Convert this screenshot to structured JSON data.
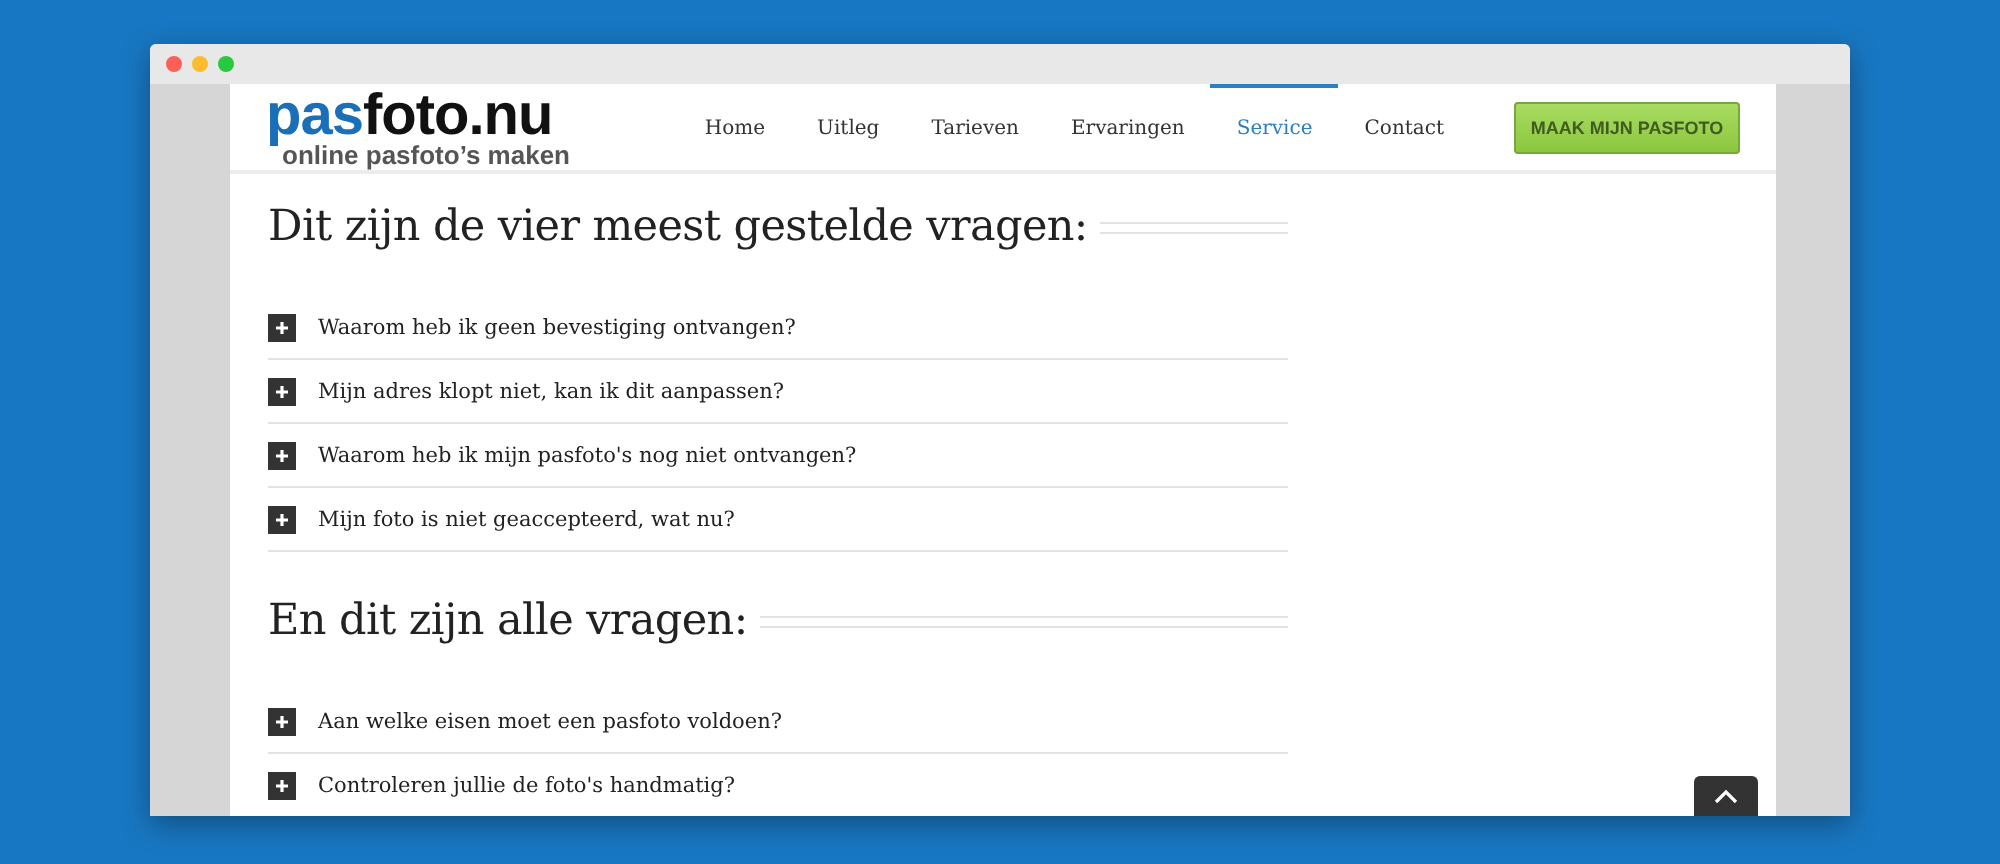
{
  "header": {
    "logo": {
      "wordmark": [
        {
          "text": "pas",
          "color": "#1a6fb8"
        },
        {
          "text": "foto.nu",
          "color": "#111111"
        }
      ],
      "tagline": "online pasfoto’s maken"
    },
    "nav": [
      {
        "label": "Home",
        "selected": false
      },
      {
        "label": "Uitleg",
        "selected": false
      },
      {
        "label": "Tarieven",
        "selected": false
      },
      {
        "label": "Ervaringen",
        "selected": false
      },
      {
        "label": "Service",
        "selected": true
      },
      {
        "label": "Contact",
        "selected": false
      }
    ],
    "cta": "MAAK MIJN PASFOTO"
  },
  "sections": [
    {
      "title": "Dit zijn de vier meest gestelde vragen:",
      "questions": [
        {
          "text": "Waarom heb ik geen bevestiging ontvangen?",
          "expanded": false
        },
        {
          "text": "Mijn adres klopt niet, kan ik dit aanpassen?",
          "expanded": false
        },
        {
          "text": "Waarom heb ik mijn pasfoto's nog niet ontvangen?",
          "expanded": false
        },
        {
          "text": "Mijn foto is niet geaccepteerd, wat nu?",
          "expanded": false
        }
      ]
    },
    {
      "title": "En dit zijn alle vragen:",
      "questions": [
        {
          "text": "Aan welke eisen moet een pasfoto voldoen?",
          "expanded": false
        },
        {
          "text": "Controleren jullie de foto's handmatig?",
          "expanded": false
        }
      ]
    }
  ]
}
